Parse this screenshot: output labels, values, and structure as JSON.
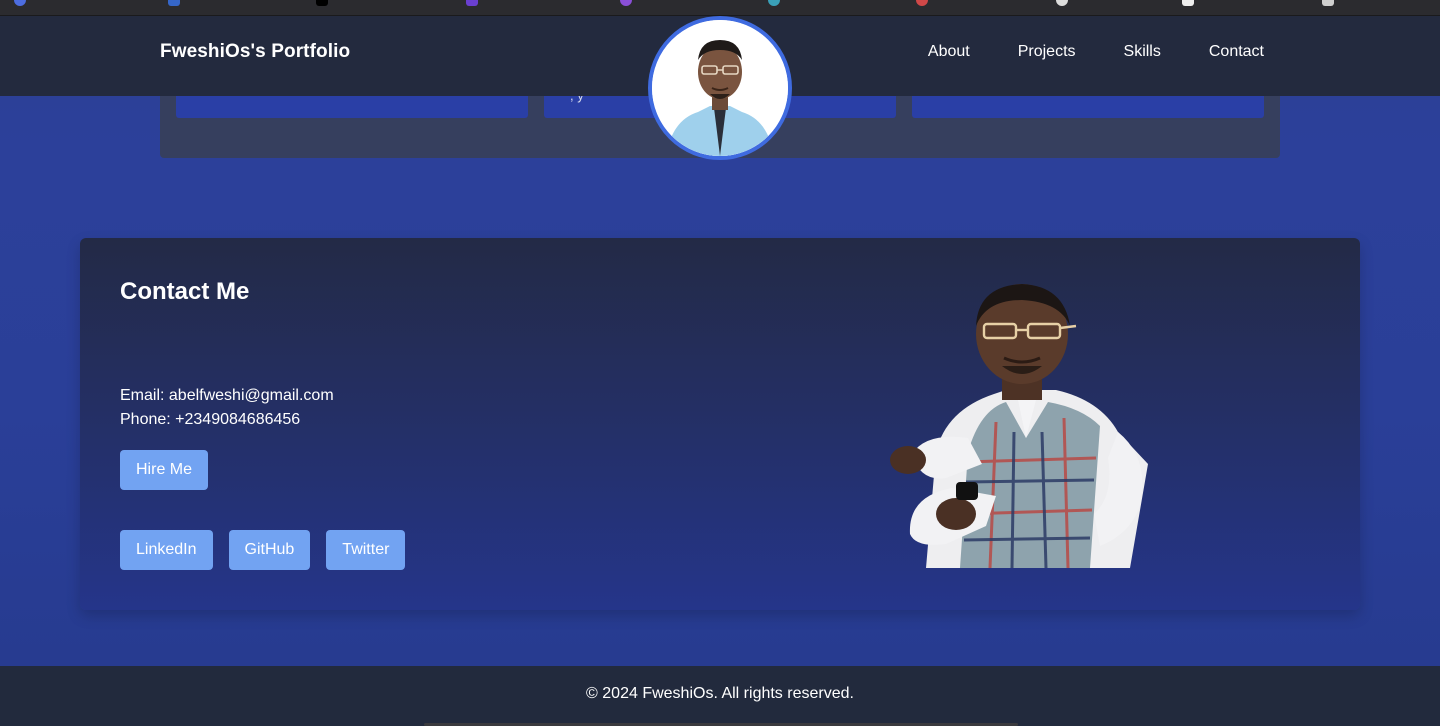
{
  "navbar": {
    "brand": "FweshiOs's Portfolio",
    "links": [
      {
        "label": "About"
      },
      {
        "label": "Projects"
      },
      {
        "label": "Skills"
      },
      {
        "label": "Contact"
      }
    ]
  },
  "projects_strip": {
    "cards": [
      {
        "peek_text": ""
      },
      {
        "peek_text": ", y"
      },
      {
        "peek_text": ""
      }
    ]
  },
  "contact": {
    "title": "Contact Me",
    "email_line": "Email: abelfweshi@gmail.com",
    "phone_line": "Phone: +2349084686456",
    "hire_label": "Hire Me",
    "socials": [
      {
        "label": "LinkedIn"
      },
      {
        "label": "GitHub"
      },
      {
        "label": "Twitter"
      }
    ]
  },
  "footer": {
    "text": "© 2024 FweshiOs. All rights reserved."
  },
  "colors": {
    "page_background": "#2a3f97",
    "navbar": "#232a3e",
    "button": "#72a3f2",
    "avatar_ring": "#3f6be0",
    "project_card": "#2a3fa6"
  }
}
